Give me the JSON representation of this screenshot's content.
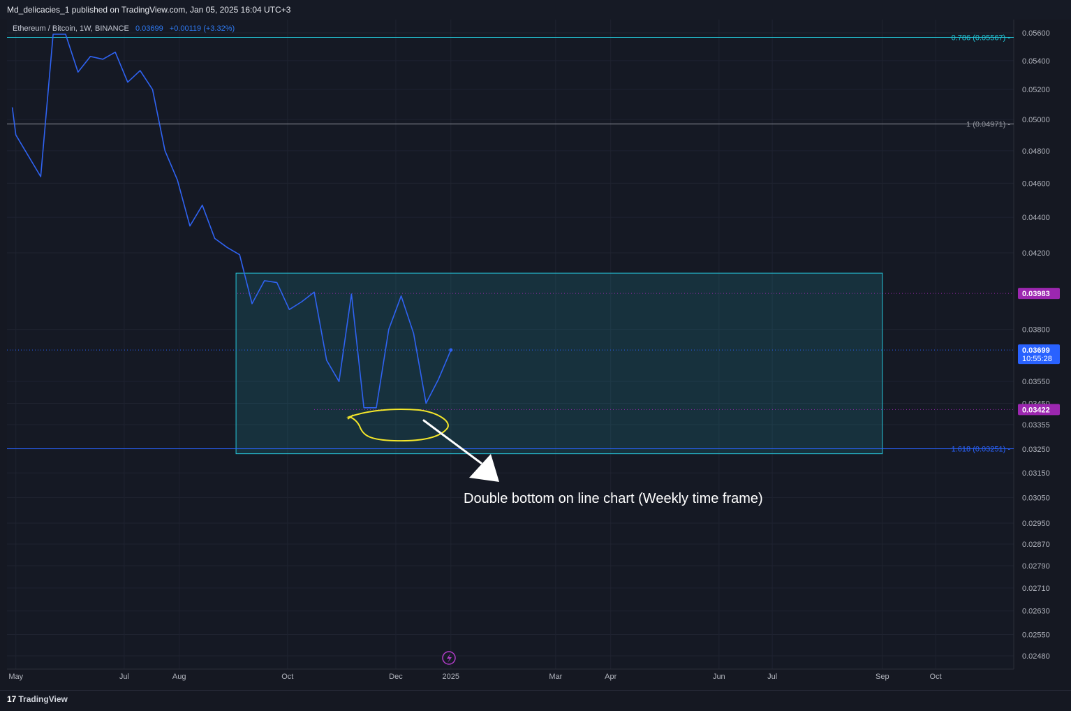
{
  "header": {
    "publish_text": "Md_delicacies_1 published on TradingView.com, Jan 05, 2025 16:04 UTC+3"
  },
  "legend": {
    "symbol": "Ethereum / Bitcoin, 1W, BINANCE",
    "price": "0.03699",
    "change": "+0.00119 (+3.32%)"
  },
  "footer": {
    "logo_text": "TradingView"
  },
  "chart_data": {
    "type": "line",
    "series": [
      {
        "color": "#2f63f2",
        "points": [
          [
            "2024-04-29",
            0.0508
          ],
          [
            "2024-05-01",
            0.049
          ],
          [
            "2024-05-15",
            0.0464
          ],
          [
            "2024-05-22",
            0.0559
          ],
          [
            "2024-05-29",
            0.0559
          ],
          [
            "2024-06-05",
            0.0532
          ],
          [
            "2024-06-12",
            0.0543
          ],
          [
            "2024-06-19",
            0.0541
          ],
          [
            "2024-06-26",
            0.0546
          ],
          [
            "2024-07-03",
            0.0525
          ],
          [
            "2024-07-10",
            0.0533
          ],
          [
            "2024-07-17",
            0.052
          ],
          [
            "2024-07-24",
            0.048
          ],
          [
            "2024-07-31",
            0.0462
          ],
          [
            "2024-08-07",
            0.0435
          ],
          [
            "2024-08-14",
            0.0447
          ],
          [
            "2024-08-21",
            0.0428
          ],
          [
            "2024-08-28",
            0.0423
          ],
          [
            "2024-09-04",
            0.0419
          ],
          [
            "2024-09-11",
            0.0393
          ],
          [
            "2024-09-18",
            0.0405
          ],
          [
            "2024-09-25",
            0.0404
          ],
          [
            "2024-10-02",
            0.039
          ],
          [
            "2024-10-09",
            0.0394
          ],
          [
            "2024-10-16",
            0.0399
          ],
          [
            "2024-10-23",
            0.0365
          ],
          [
            "2024-10-30",
            0.0355
          ],
          [
            "2024-11-06",
            0.0398
          ],
          [
            "2024-11-13",
            0.0343
          ],
          [
            "2024-11-20",
            0.0343
          ],
          [
            "2024-11-27",
            0.038
          ],
          [
            "2024-12-04",
            0.0397
          ],
          [
            "2024-12-11",
            0.0378
          ],
          [
            "2024-12-18",
            0.0345
          ],
          [
            "2024-12-25",
            0.0356
          ],
          [
            "2025-01-01",
            0.03699
          ]
        ]
      }
    ],
    "y_axis": {
      "ticks": [
        "0.05600",
        "0.05400",
        "0.05200",
        "0.05000",
        "0.04800",
        "0.04600",
        "0.04400",
        "0.04200",
        "0.03800",
        "0.03550",
        "0.03450",
        "0.03355",
        "0.03250",
        "0.03150",
        "0.03050",
        "0.02950",
        "0.02870",
        "0.02790",
        "0.02710",
        "0.02630",
        "0.02550",
        "0.02480"
      ],
      "scale": "log"
    },
    "x_axis": {
      "ticks": [
        "May",
        "Jul",
        "Aug",
        "Oct",
        "Dec",
        "2025",
        "Mar",
        "Apr",
        "Jun",
        "Jul",
        "Sep",
        "Oct"
      ]
    },
    "grid": true,
    "fib_levels": [
      {
        "label": "0.786 (0.05567)",
        "value": 0.05567,
        "color": "#22c6d8"
      },
      {
        "label": "1 (0.04971)",
        "value": 0.04971,
        "color": "#9598a1"
      },
      {
        "label": "1.618 (0.03251)",
        "value": 0.03251,
        "color": "#2962ff"
      }
    ],
    "price_labels": [
      {
        "text": "0.03983",
        "value": 0.03983,
        "color": "#9c27b0"
      },
      {
        "text": "0.03699",
        "subtext": "10:55:28",
        "value": 0.03699,
        "color": "#2962ff"
      },
      {
        "text": "0.03422",
        "value": 0.03422,
        "color": "#9c27b0"
      }
    ],
    "zone": {
      "from": "2024-09-02",
      "to": "2025-09-01",
      "top": 0.0409,
      "bottom": 0.0323,
      "color": "#26c6da"
    },
    "annotation": {
      "text": "Double bottom on line chart (Weekly time frame)",
      "marker_color": "#f5e72a"
    },
    "event_icon": "lightning-icon"
  }
}
